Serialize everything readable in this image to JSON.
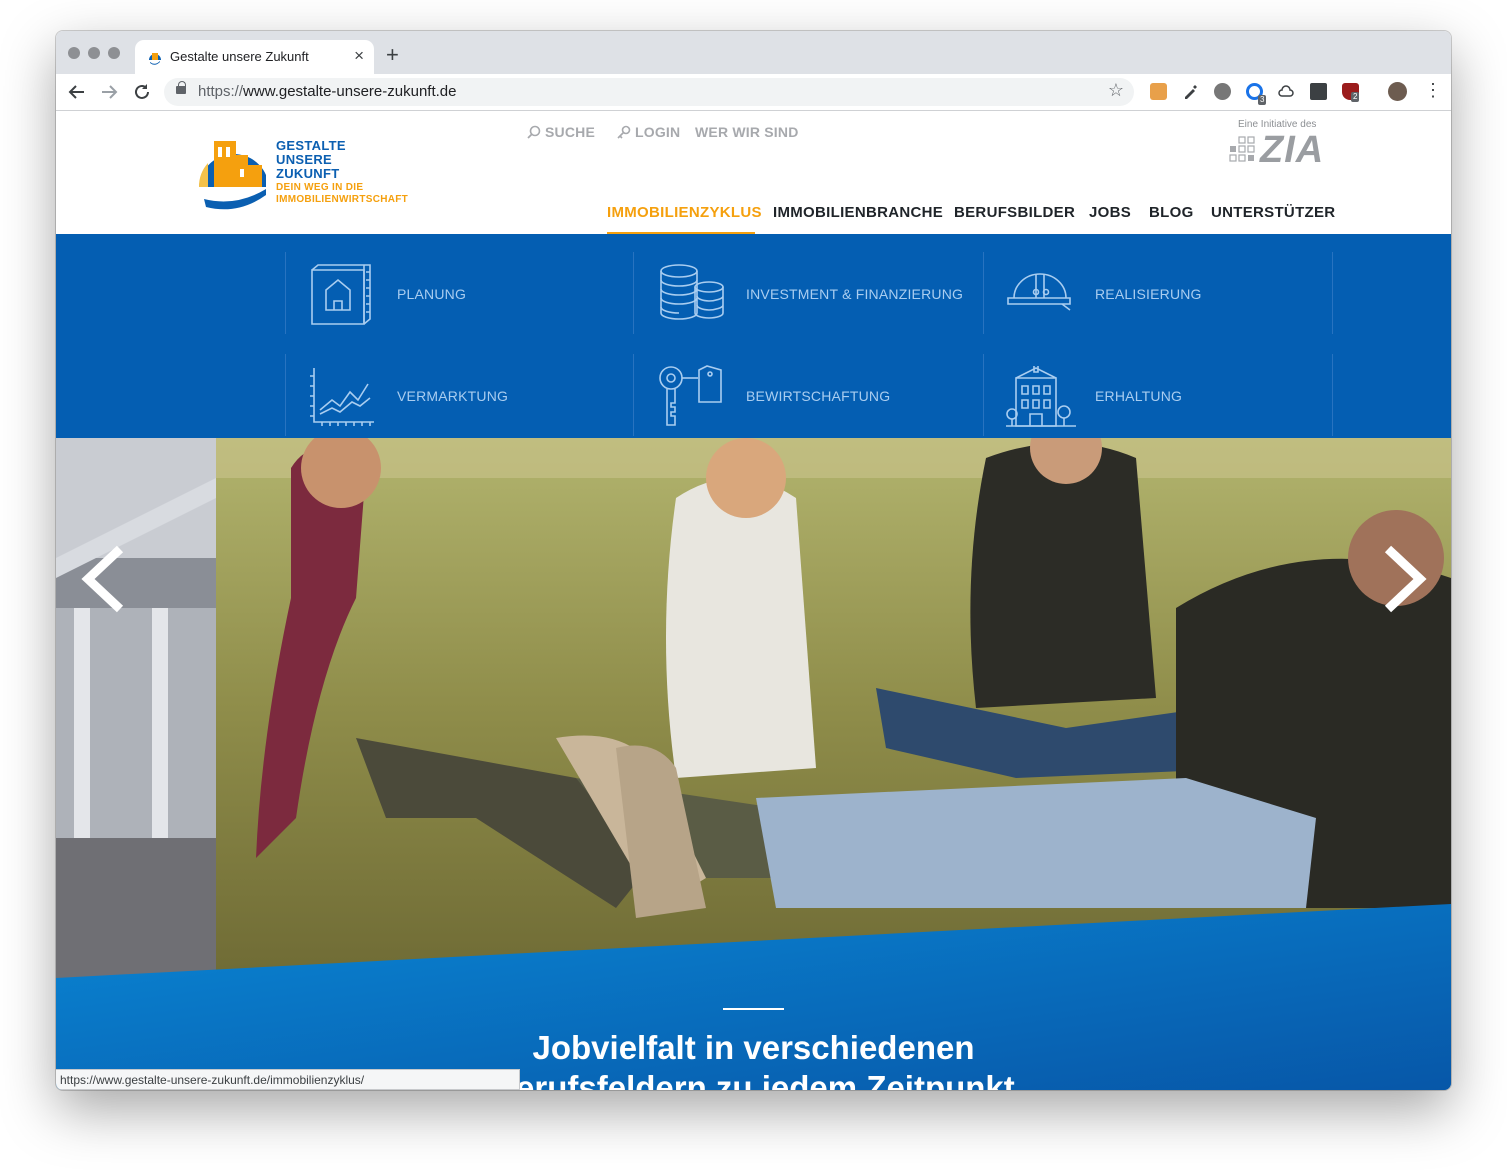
{
  "browser": {
    "tab_title": "Gestalte unsere Zukunft",
    "tab_close": "×",
    "new_tab": "+",
    "url_scheme": "https://",
    "url_rest": "www.gestalte-unsere-zukunft.de",
    "status_url": "https://www.gestalte-unsere-zukunft.de/immobilienzyklus/",
    "extension_badges": [
      "3",
      "2"
    ]
  },
  "header": {
    "logo_lines": [
      "GESTALTE",
      "UNSERE",
      "ZUKUNFT"
    ],
    "slogan_lines": [
      "DEIN WEG IN DIE",
      "IMMOBILIENWIRTSCHAFT"
    ],
    "utility_links": [
      "SUCHE",
      "LOGIN",
      "WER WIR SIND"
    ],
    "zia_small": "Eine Initiative des",
    "zia_big": "ZIA"
  },
  "main_nav": {
    "items": [
      "IMMOBILIENZYKLUS",
      "IMMOBILIENBRANCHE",
      "BERUFSBILDER",
      "JOBS",
      "BLOG",
      "UNTERSTÜTZER"
    ],
    "active": "IMMOBILIENZYKLUS"
  },
  "mega_menu": {
    "items": [
      {
        "label": "PLANUNG",
        "icon": "blueprint-icon"
      },
      {
        "label": "INVESTMENT & FINANZIERUNG",
        "icon": "coin-stack-icon"
      },
      {
        "label": "REALISIERUNG",
        "icon": "hard-hat-icon"
      },
      {
        "label": "VERMARKTUNG",
        "icon": "line-chart-icon"
      },
      {
        "label": "BEWIRTSCHAFTUNG",
        "icon": "key-tag-icon"
      },
      {
        "label": "ERHALTUNG",
        "icon": "building-icon"
      }
    ]
  },
  "hero": {
    "headline_lines": [
      "Jobvielfalt in verschiedenen",
      "Berufsfeldern zu jedem Zeitpunkt"
    ]
  },
  "colors": {
    "brand_blue": "#045eb2",
    "accent_orange": "#f5a00e"
  }
}
